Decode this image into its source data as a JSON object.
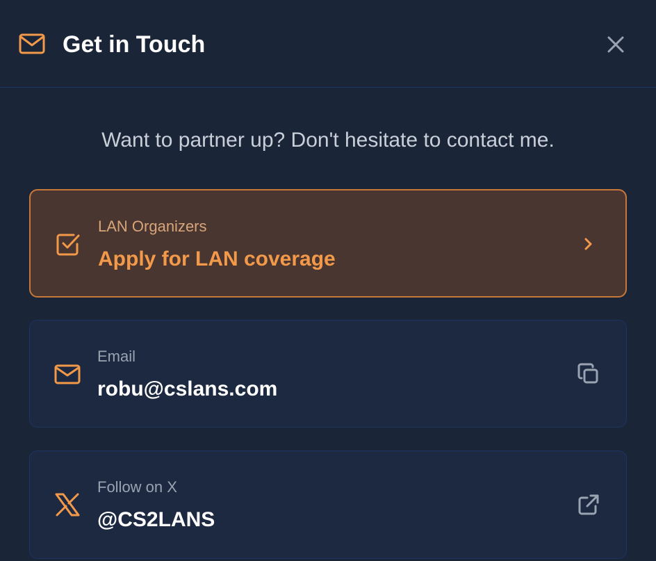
{
  "header": {
    "title": "Get in Touch",
    "icon": "mail-icon",
    "close_icon": "close-icon"
  },
  "subtitle": "Want to partner up? Don't hesitate to contact me.",
  "cards": [
    {
      "label": "LAN Organizers",
      "value": "Apply for LAN coverage",
      "icon": "checkbox-icon",
      "action_icon": "chevron-right-icon"
    },
    {
      "label": "Email",
      "value": "robu@cslans.com",
      "icon": "mail-icon",
      "action_icon": "copy-icon"
    },
    {
      "label": "Follow on X",
      "value": "@CS2LANS",
      "icon": "x-logo-icon",
      "action_icon": "external-link-icon"
    }
  ],
  "colors": {
    "background": "#1b2538",
    "accent": "#f2994a",
    "highlight_card": "#4a3630",
    "card": "#1d2940",
    "border": "#1f3463"
  }
}
